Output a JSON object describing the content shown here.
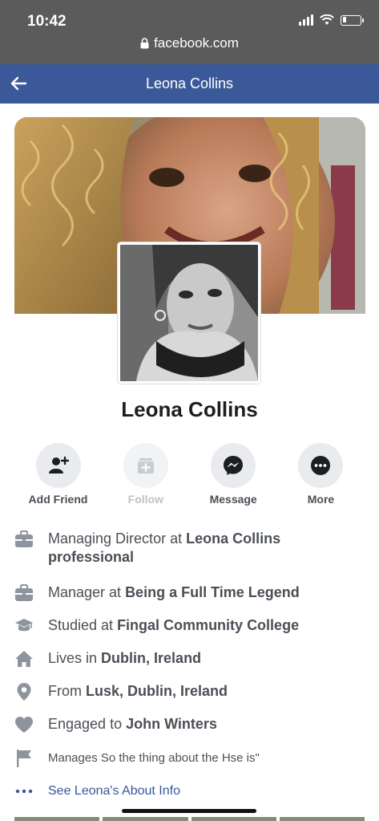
{
  "status_bar": {
    "time": "10:42",
    "battery_level": 0.2
  },
  "browser": {
    "url": "facebook.com"
  },
  "nav": {
    "title": "Leona Collins",
    "back_icon": "arrow-left-icon"
  },
  "profile": {
    "name": "Leona Collins"
  },
  "actions": [
    {
      "label": "Add Friend",
      "icon": "add-friend-icon",
      "enabled": true
    },
    {
      "label": "Follow",
      "icon": "follow-icon",
      "enabled": false
    },
    {
      "label": "Message",
      "icon": "messenger-icon",
      "enabled": true
    },
    {
      "label": "More",
      "icon": "more-icon",
      "enabled": true
    }
  ],
  "info": {
    "work1": {
      "prefix": "Managing Director at ",
      "bold": "Leona Collins professional"
    },
    "work2": {
      "prefix": "Manager at ",
      "bold": "Being a Full Time Legend"
    },
    "education": {
      "prefix": "Studied at ",
      "bold": "Fingal Community College"
    },
    "lives": {
      "prefix": "Lives in ",
      "bold": "Dublin, Ireland"
    },
    "from": {
      "prefix": "From ",
      "bold": "Lusk, Dublin, Ireland"
    },
    "relationship": {
      "prefix": "Engaged to ",
      "bold": "John Winters"
    },
    "manages": {
      "text": "Manages So the thing about the Hse is\""
    },
    "see_about": {
      "text": "See Leona's About Info"
    }
  },
  "colors": {
    "nav_blue": "#3b5998",
    "link_blue": "#365899",
    "status_gray": "#5b5b5b"
  }
}
